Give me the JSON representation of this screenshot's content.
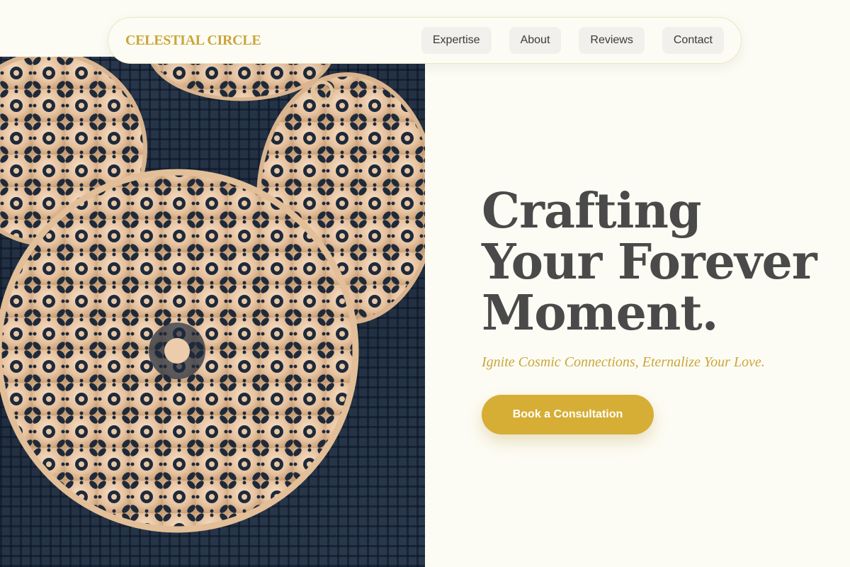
{
  "brand": {
    "name": "CELESTIAL CIRCLE"
  },
  "nav": {
    "items": [
      {
        "label": "Expertise"
      },
      {
        "label": "About"
      },
      {
        "label": "Reviews"
      },
      {
        "label": "Contact"
      }
    ]
  },
  "hero": {
    "title_lines": [
      "Crafting",
      "Your Forever",
      "Moment."
    ],
    "tagline": "Ignite Cosmic Connections, Eternalize Your Love.",
    "cta_label": "Book a Consultation",
    "image_alt": "Gold filigree earrings on dark mesh"
  },
  "colors": {
    "accent_gold": "#d6ae35",
    "brand_gold": "#c9a63c",
    "title_gray": "#4a4a4a",
    "background": "#fdfcf4",
    "nav_button_bg": "#f1f0ec"
  }
}
